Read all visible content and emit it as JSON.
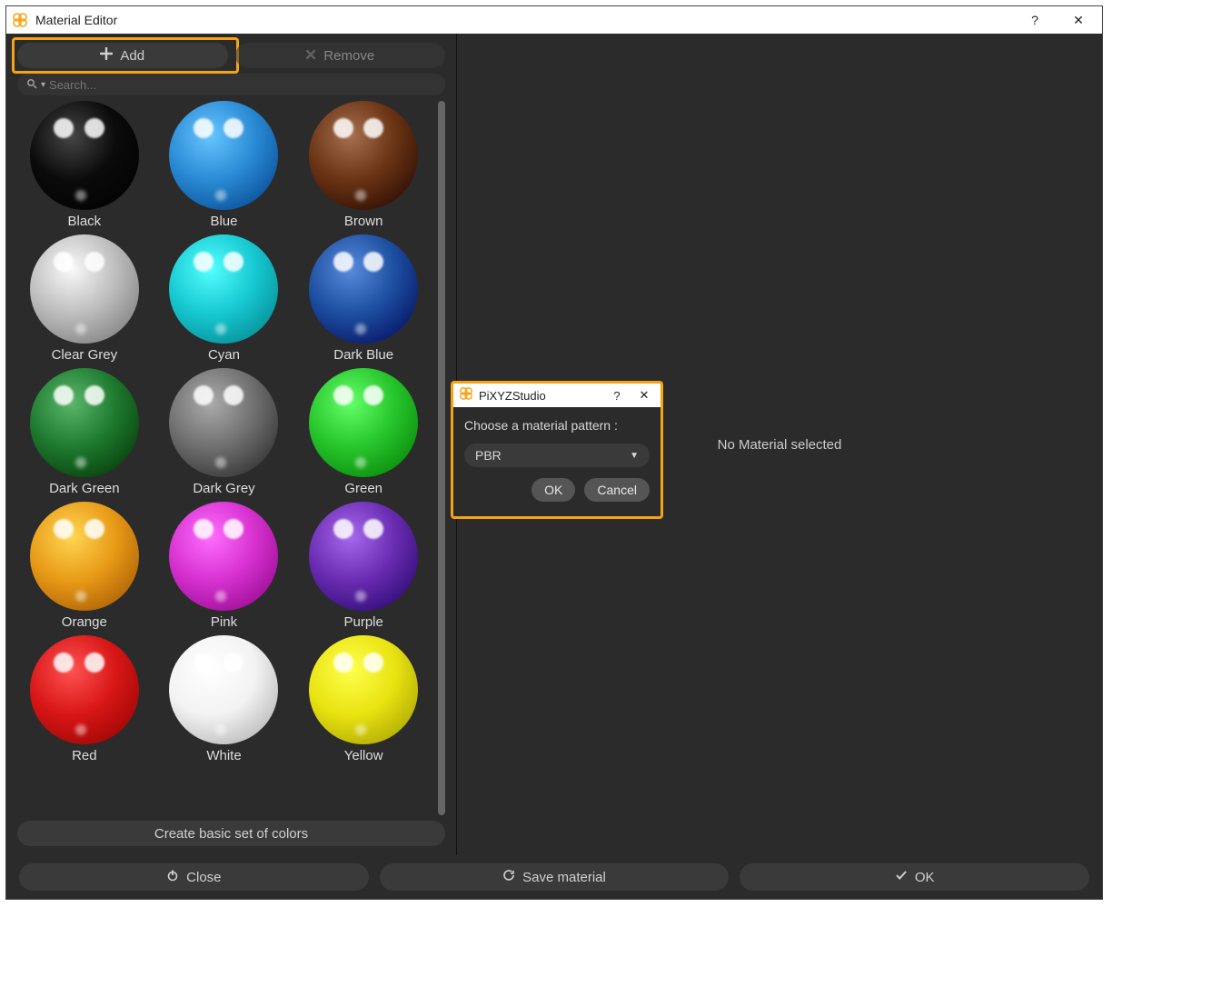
{
  "window": {
    "title": "Material Editor",
    "help": "?",
    "close": "✕"
  },
  "toolbar": {
    "add_label": "Add",
    "remove_label": "Remove"
  },
  "search": {
    "placeholder": "Search..."
  },
  "materials": [
    {
      "name": "Black",
      "color": "#0a0a0a"
    },
    {
      "name": "Blue",
      "color": "#2a8ad4"
    },
    {
      "name": "Brown",
      "color": "#6a3414"
    },
    {
      "name": "Clear Grey",
      "color": "#bdbdbd"
    },
    {
      "name": "Cyan",
      "color": "#17c8d1"
    },
    {
      "name": "Dark Blue",
      "color": "#1d4fa1"
    },
    {
      "name": "Dark Green",
      "color": "#1e7a2e"
    },
    {
      "name": "Dark Grey",
      "color": "#6f6f6f"
    },
    {
      "name": "Green",
      "color": "#27c52c"
    },
    {
      "name": "Orange",
      "color": "#e79a16"
    },
    {
      "name": "Pink",
      "color": "#d631cf"
    },
    {
      "name": "Purple",
      "color": "#6a2cb1"
    },
    {
      "name": "Red",
      "color": "#d81616"
    },
    {
      "name": "White",
      "color": "#f3f3f3"
    },
    {
      "name": "Yellow",
      "color": "#e9e311"
    }
  ],
  "basic_button": "Create basic set of colors",
  "right_panel": {
    "empty_text": "No Material selected"
  },
  "footer": {
    "close": "Close",
    "save": "Save material",
    "ok": "OK"
  },
  "dialog": {
    "title": "PiXYZStudio",
    "help": "?",
    "close": "✕",
    "prompt": "Choose a material pattern :",
    "selected": "PBR",
    "ok": "OK",
    "cancel": "Cancel"
  },
  "colors": {
    "accent": "#f5a316"
  }
}
